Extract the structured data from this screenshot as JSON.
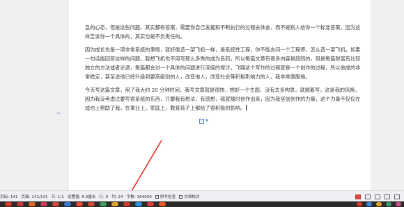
{
  "document": {
    "paragraphs": [
      {
        "text": "急的心态，但是这些问题，其实都有答案，需要你自己发掘和不断执行的过程去体会，而不是别人给你一个标准答案，因为这样告诉你一个具体的，其实也是不负责任的。"
      },
      {
        "text": "因为成长也是一项非常系统的事情，就好像造一架飞机一样，是系统性工程，你不能去问一个工程师，怎么造一架飞机，如果一句话能回答这样的问题，我想飞机也不用写那么多秀的成为良药，所以每篇文章有很多内容是趋同的，但是每篇财富有比较独立的方法或者论调，每篇都会对一个具体的问题进行深度的探讨，飞翔这个写作的过程就是一个创作的过程，所以他成的非常稳定，甚至说他已经升级到更高级别的人，改变他人，改变社会等积极影响力的人，我非常佩服他。"
      },
      {
        "text": "今天写这篇文章，用了我大约 20 分钟时间，我写文章就是很快，想好一个主题，没有太多构思，就顺着写，这是我的风格，因为我没考虑过要写很系统的东西，只要我有想法，有感想，我就随时创作出来，因为我坚信创作的力量，这个力量不仅仅在成也上帮助了我，在事业上，家庭上，教育孩子上都给了很积极的影响。"
      }
    ]
  },
  "status_bar": {
    "page_label": "页码: 141",
    "pages_label": "页面: 141/141",
    "section_label": "节: 1/1",
    "setting_label": "设置值: 6.9厘米",
    "row_label": "行: 9",
    "col_label": "列: 24",
    "word_count_label": "字数: 164000",
    "spellcheck_label": "拼写检查",
    "proofread_label": "文档校对"
  },
  "colors": {
    "arrow": "#e8322a",
    "statusbar_bg": "#eef0f3",
    "taskbar_bg": "#2b2b2b"
  },
  "taskbar": {
    "icons": [
      "app-icon-1",
      "app-icon-2",
      "app-icon-3",
      "app-icon-4",
      "app-icon-5",
      "app-icon-6",
      "app-icon-7",
      "app-icon-8",
      "app-icon-9",
      "app-icon-10",
      "app-icon-11",
      "app-icon-12",
      "app-icon-13",
      "app-icon-14",
      "app-icon-15",
      "app-icon-16",
      "app-icon-17",
      "app-icon-18",
      "app-icon-19"
    ]
  }
}
